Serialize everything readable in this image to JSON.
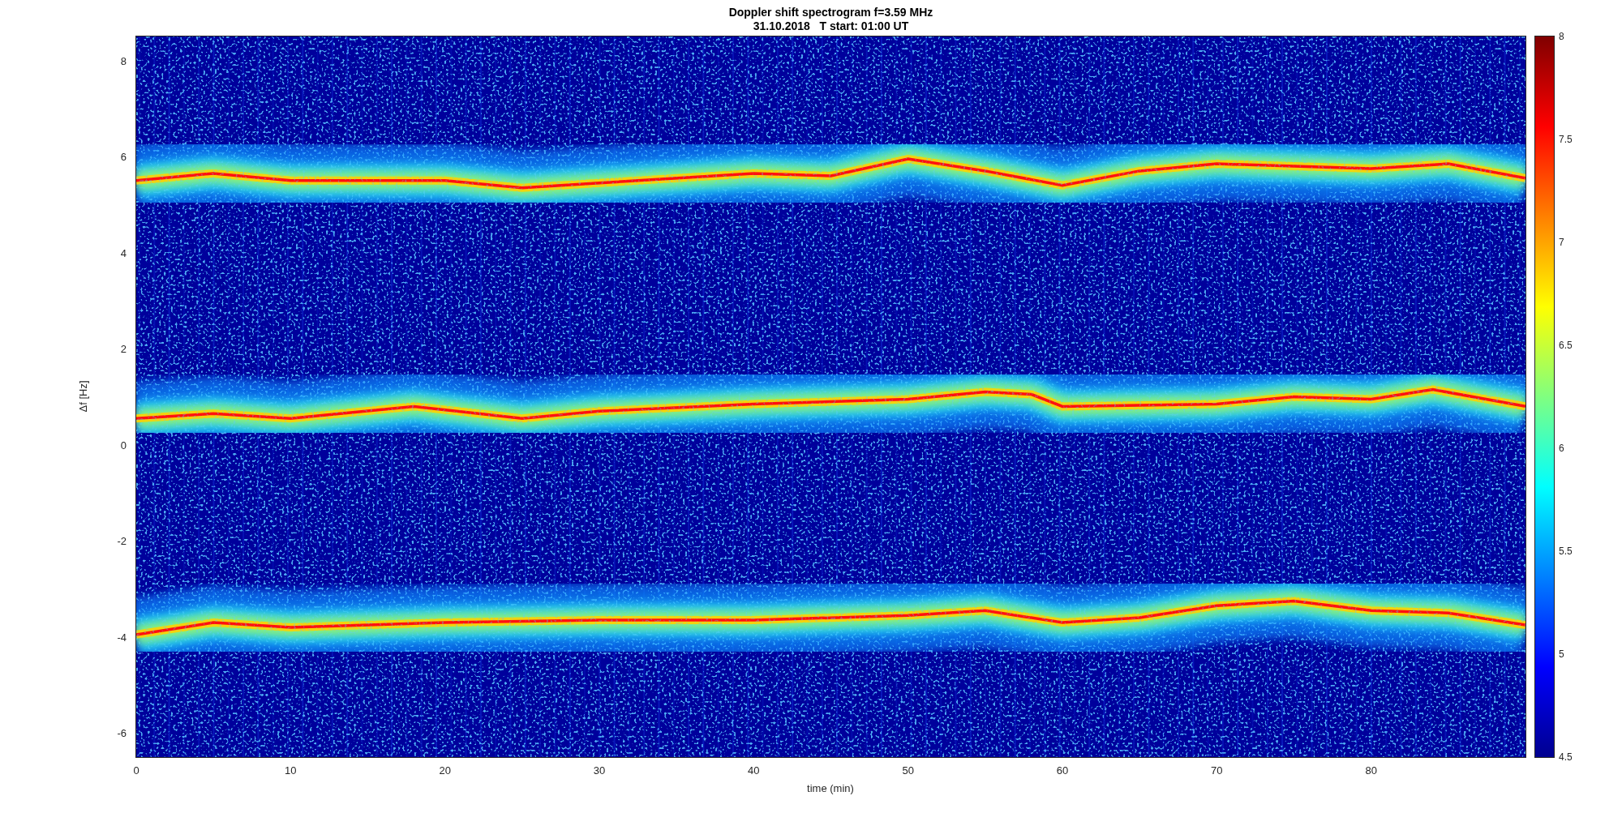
{
  "title": {
    "lines": [
      "Doppler shift spectrogram f=3.59 MHz",
      "31.10.2018   T start: 01:00 UT"
    ]
  },
  "axes": {
    "ylabel": "Δf [Hz]",
    "xlabel": "time (min)",
    "yticks": [
      "8",
      "6",
      "4",
      "2",
      "0",
      "-2",
      "-4",
      "-6"
    ],
    "xticks": [
      "0",
      "10",
      "20",
      "30",
      "40",
      "50",
      "60",
      "70",
      "80"
    ]
  },
  "colorbar": {
    "ticks": [
      "8",
      "7.5",
      "7",
      "6.5",
      "6",
      "5.5",
      "5",
      "4.5"
    ]
  }
}
